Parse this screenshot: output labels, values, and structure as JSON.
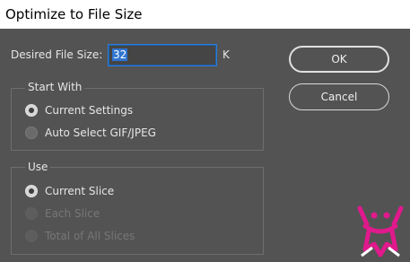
{
  "window": {
    "title": "Optimize to File Size"
  },
  "size": {
    "label": "Desired File Size:",
    "value": "32",
    "unit": "K"
  },
  "buttons": {
    "ok": "OK",
    "cancel": "Cancel"
  },
  "start_with": {
    "title": "Start With",
    "options": [
      {
        "label": "Current Settings",
        "checked": true,
        "enabled": true
      },
      {
        "label": "Auto Select GIF/JPEG",
        "checked": false,
        "enabled": true
      }
    ]
  },
  "use": {
    "title": "Use",
    "options": [
      {
        "label": "Current Slice",
        "checked": true,
        "enabled": true
      },
      {
        "label": "Each Slice",
        "checked": false,
        "enabled": false
      },
      {
        "label": "Total of All Slices",
        "checked": false,
        "enabled": false
      }
    ]
  },
  "colors": {
    "background": "#535353",
    "accent": "#2c7cd6",
    "logo": "#e0198c"
  },
  "icons": {
    "watermark": "mascot-logo-icon"
  }
}
